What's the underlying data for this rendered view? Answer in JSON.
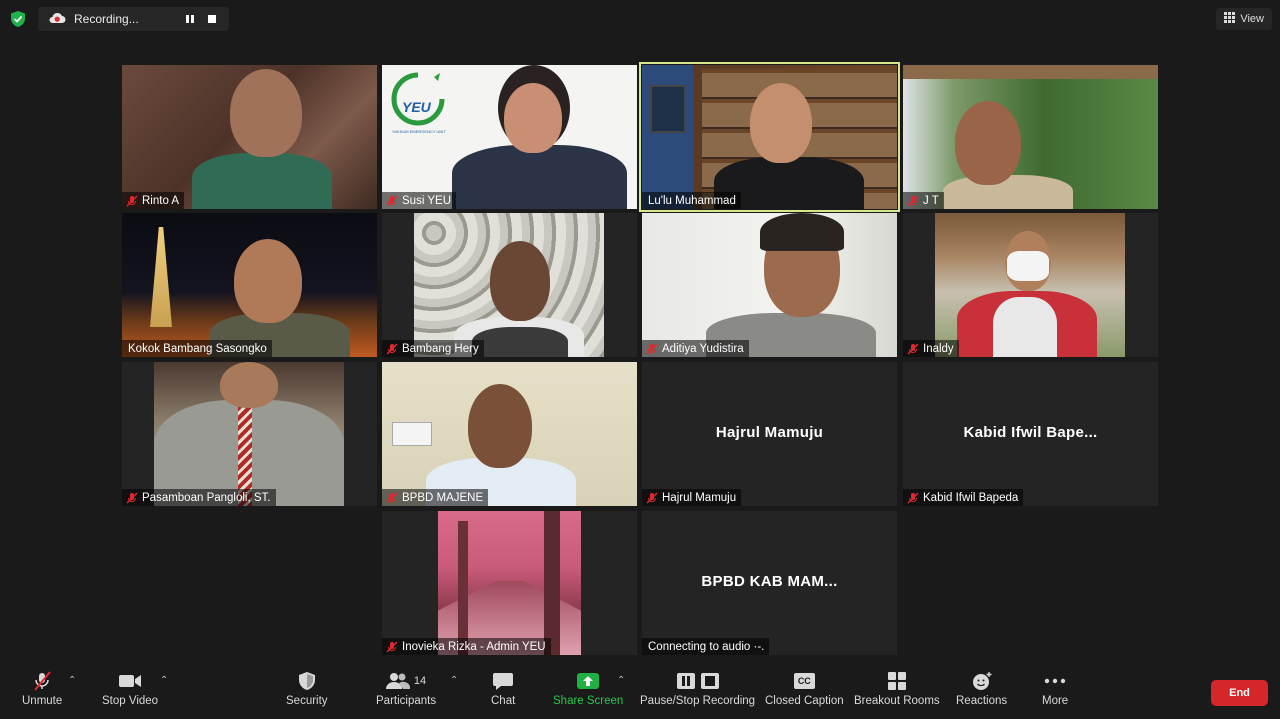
{
  "recording": {
    "label": "Recording..."
  },
  "view_button": {
    "label": "View"
  },
  "participants": [
    {
      "name": "Rinto A",
      "muted": true
    },
    {
      "name": "Susi YEU",
      "muted": true
    },
    {
      "name": "Lu'lu Muhammad",
      "muted": false,
      "active_speaker": true
    },
    {
      "name": "J T",
      "muted": true
    },
    {
      "name": "Kokok Bambang Sasongko",
      "muted": false
    },
    {
      "name": "Bambang Hery",
      "muted": true
    },
    {
      "name": "Aditiya Yudistira",
      "muted": true
    },
    {
      "name": "Inaldy",
      "muted": true
    },
    {
      "name": "Pasamboan Pangloli, ST.",
      "muted": true
    },
    {
      "name": "BPBD MAJENE",
      "muted": true
    },
    {
      "name": "Hajrul Mamuju",
      "display": "Hajrul Mamuju",
      "muted": true
    },
    {
      "name": "Kabid Ifwil Bapeda",
      "display": "Kabid Ifwil Bape...",
      "muted": true
    },
    {
      "name": "Inovieka Rizka - Admin YEU",
      "muted": true
    },
    {
      "name": "Connecting to audio ·-.",
      "display": "BPBD KAB MAM...",
      "muted": false
    }
  ],
  "yeu_logo": {
    "text": "YEU",
    "subtext": "YAKKUM EMERGENCY UNIT"
  },
  "toolbar": {
    "unmute": "Unmute",
    "stop_video": "Stop Video",
    "security": "Security",
    "participants": "Participants",
    "participants_count": "14",
    "chat": "Chat",
    "share_screen": "Share Screen",
    "pause_stop_recording": "Pause/Stop Recording",
    "closed_caption": "Closed Caption",
    "cc_badge": "CC",
    "breakout_rooms": "Breakout Rooms",
    "reactions": "Reactions",
    "more": "More",
    "end": "End"
  },
  "colors": {
    "background": "#1a1a1a",
    "tile": "#242424",
    "active_speaker_border": "#d6e68a",
    "mute_red": "#e0282e",
    "share_green": "#1fb141",
    "end_red": "#d5262a"
  }
}
